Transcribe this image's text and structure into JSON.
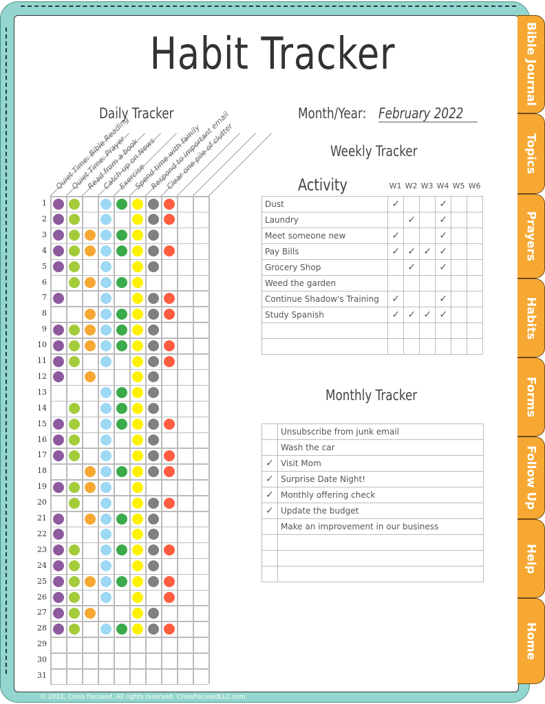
{
  "title": "Habit Tracker",
  "daily_tracker": {
    "heading": "Daily Tracker",
    "habits": [
      {
        "label": "Quiet Time: Bible Reading",
        "color": "#8e5a9e"
      },
      {
        "label": "Quiet Time: Prayer",
        "color": "#a3cc3a"
      },
      {
        "label": "Read from a book",
        "color": "#f6a833"
      },
      {
        "label": "Catch-up on News",
        "color": "#9dd8f4"
      },
      {
        "label": "Exercise",
        "color": "#3aaa4a"
      },
      {
        "label": "Spend time with family",
        "color": "#fff200"
      },
      {
        "label": "Respond to important email",
        "color": "#808080"
      },
      {
        "label": "Clear one pile of clutter",
        "color": "#ff5c40"
      },
      {
        "label": "",
        "color": ""
      },
      {
        "label": "",
        "color": ""
      }
    ],
    "days": [
      "1",
      "2",
      "3",
      "4",
      "5",
      "6",
      "7",
      "8",
      "9",
      "10",
      "11",
      "12",
      "13",
      "14",
      "15",
      "16",
      "17",
      "18",
      "19",
      "20",
      "21",
      "22",
      "23",
      "24",
      "25",
      "26",
      "27",
      "28",
      "29",
      "30",
      "31"
    ],
    "completed": [
      "11011111",
      "11010111",
      "11111110",
      "11111111",
      "11010110",
      "01111100",
      "10010111",
      "00111111",
      "11111110",
      "11111111",
      "11010111",
      "10100110",
      "00011110",
      "01011110",
      "11011111",
      "11010110",
      "11010111",
      "00111111",
      "11110100",
      "01010111",
      "10111110",
      "10010110",
      "11011111",
      "11010110",
      "11111111",
      "11010101",
      "11100110",
      "11011111",
      "00000000",
      "00000000",
      "00000000"
    ]
  },
  "month_year": {
    "label": "Month/Year:",
    "value": "February 2022"
  },
  "weekly_tracker": {
    "heading": "Weekly Tracker",
    "activity_header": "Activity",
    "weeks": [
      "W1",
      "W2",
      "W3",
      "W4",
      "W5",
      "W6"
    ],
    "check_glyph": "✓",
    "rows": [
      {
        "activity": "Dust",
        "checks": [
          1,
          0,
          0,
          1,
          0,
          0
        ]
      },
      {
        "activity": "Laundry",
        "checks": [
          0,
          1,
          0,
          1,
          0,
          0
        ]
      },
      {
        "activity": "Meet someone new",
        "checks": [
          1,
          0,
          0,
          1,
          0,
          0
        ]
      },
      {
        "activity": "Pay Bills",
        "checks": [
          1,
          1,
          1,
          1,
          0,
          0
        ]
      },
      {
        "activity": "Grocery Shop",
        "checks": [
          0,
          1,
          0,
          1,
          0,
          0
        ]
      },
      {
        "activity": "Weed the garden",
        "checks": [
          0,
          0,
          0,
          0,
          0,
          0
        ]
      },
      {
        "activity": "Continue Shadow's Training",
        "checks": [
          1,
          0,
          0,
          1,
          0,
          0
        ]
      },
      {
        "activity": "Study Spanish",
        "checks": [
          1,
          1,
          1,
          1,
          0,
          0
        ]
      },
      {
        "activity": "",
        "checks": [
          0,
          0,
          0,
          0,
          0,
          0
        ]
      },
      {
        "activity": "",
        "checks": [
          0,
          0,
          0,
          0,
          0,
          0
        ]
      }
    ]
  },
  "monthly_tracker": {
    "heading": "Monthly Tracker",
    "rows": [
      {
        "task": "Unsubscribe from junk email",
        "done": false
      },
      {
        "task": "Wash the car",
        "done": false
      },
      {
        "task": "Visit Mom",
        "done": true
      },
      {
        "task": "Surprise Date Night!",
        "done": true
      },
      {
        "task": "Monthly offering check",
        "done": true
      },
      {
        "task": "Update the budget",
        "done": true
      },
      {
        "task": "Make an improvement in our business",
        "done": false
      },
      {
        "task": "",
        "done": false
      },
      {
        "task": "",
        "done": false
      },
      {
        "task": "",
        "done": false
      }
    ]
  },
  "tabs": [
    "Bible Journal",
    "Topics",
    "Prayers",
    "Habits",
    "Forms",
    "Follow Up",
    "Help",
    "Home"
  ],
  "colors": {
    "tab": "#f6a833",
    "frame": "#93d6cf"
  },
  "footer": "© 2022, Cross Focused. All rights reserved. CrossFocusedLLC.com"
}
